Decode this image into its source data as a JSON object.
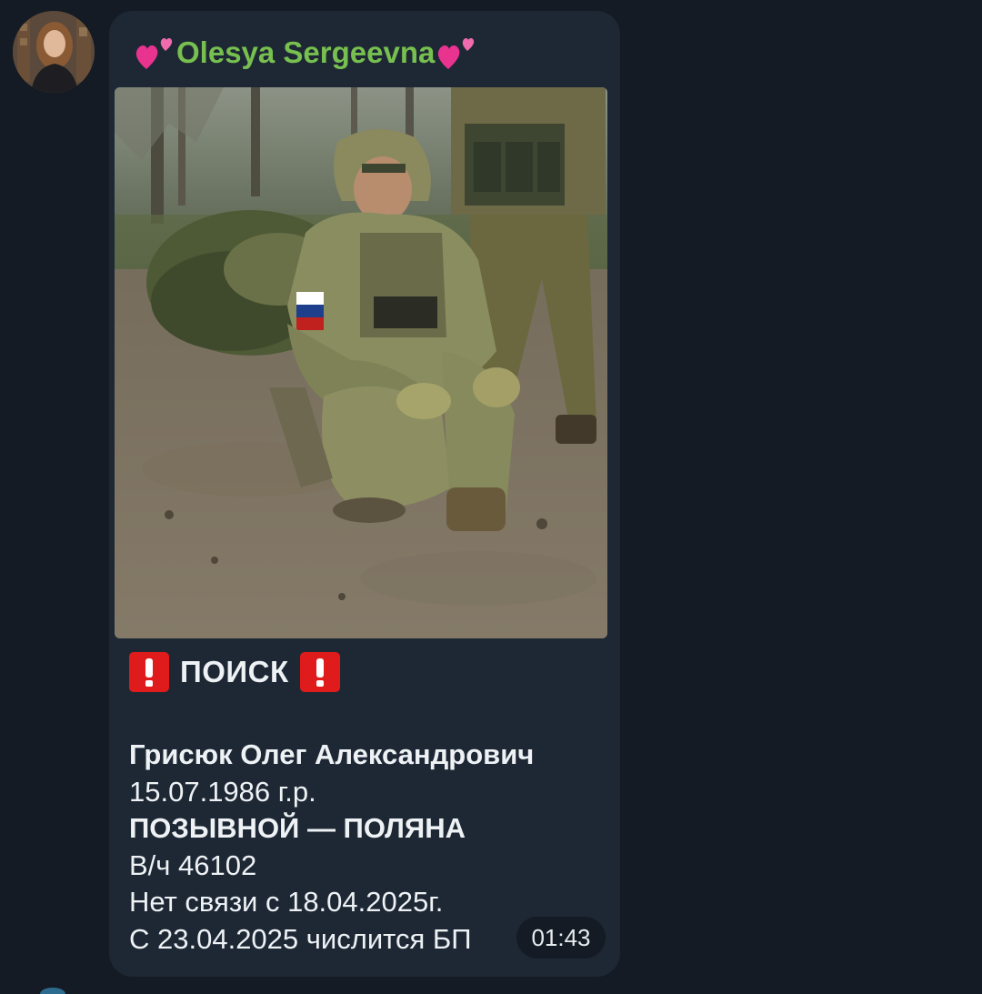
{
  "message": {
    "sender_name": "Olesya Sergeevna",
    "sender_color": "#77bf4f",
    "sender_emoji": "two-hearts-icon",
    "headline": "ПОИСК",
    "headline_icon": "exclamation-mark-icon",
    "lines": [
      "Грисюк Олег Александрович",
      "15.07.1986 г.р.",
      "ПОЗЫВНОЙ — ПОЛЯНА",
      "В/ч 46102",
      "Нет связи с 18.04.2025г.",
      "С 23.04.2025 числится БП"
    ],
    "time": "01:43"
  },
  "theme": {
    "background": "#141b24",
    "bubble": "#1e2835",
    "text": "#eef2f5",
    "alert_red": "#e01b1b"
  }
}
